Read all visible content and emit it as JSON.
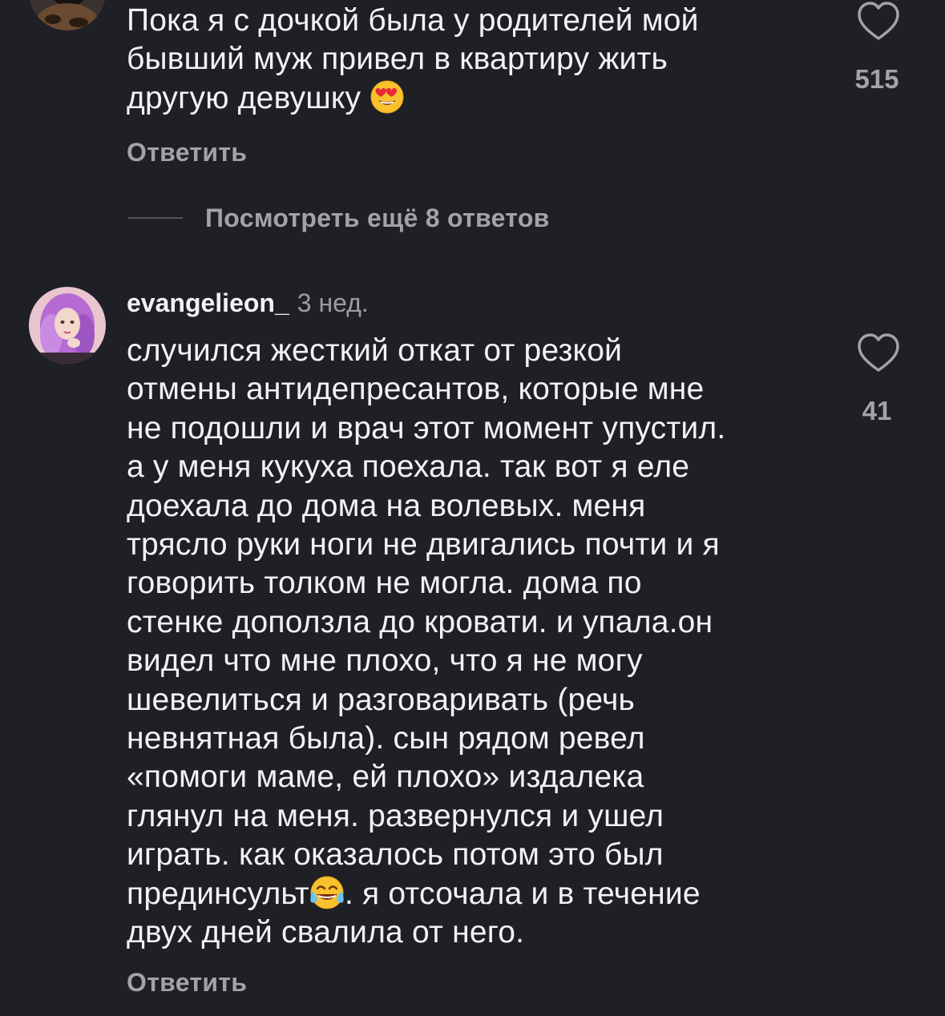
{
  "comments": [
    {
      "text": "Пока я с дочкой была у родителей мой\nбывший муж привел в квартиру жить\nдругую девушку ",
      "emoji": "heart-eyes-emoji",
      "reply_label": "Ответить",
      "like_icon": "heart-outline-icon",
      "like_count": "515"
    },
    {
      "username": "evangelieon_",
      "time": "3 нед.",
      "text_part1": "случился жесткий откат от резкой\nотмены антидепресантов, которые мне\nне подошли и врач этот момент упустил.\nа у меня кукуха поехала. так вот я еле\nдоехала до дома на волевых. меня\nтрясло руки ноги не двигались почти и я\nговорить толком не могла. дома по\nстенке доползла до кровати. и упала.он\nвидел что мне плохо, что я не могу\nшевелиться и разговаривать (речь\nневнятная была). сын рядом ревел\n«помоги маме, ей плохо» издалека\nглянул на меня. развернулся и ушел\nиграть. как оказалось потом это был\nпрединсульт",
      "emoji": "tears-of-joy-emoji",
      "text_part2": ". я отсочала и в течение\nдвух дней свалила от него.",
      "reply_label": "Ответить",
      "like_icon": "heart-outline-icon",
      "like_count": "41"
    }
  ],
  "thread": {
    "view_more_label": "Посмотреть ещё 8 ответов"
  },
  "colors": {
    "background": "#1f2026",
    "text_primary": "#f2f2f4",
    "text_secondary": "#a2a3a9",
    "accent_avatar": "#c77dd6"
  }
}
